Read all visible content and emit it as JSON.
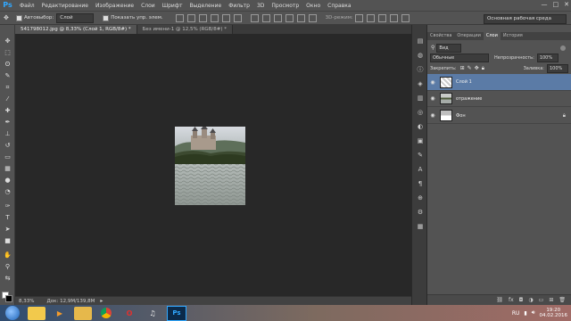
{
  "app": {
    "logo": "Ps"
  },
  "menu": [
    "Файл",
    "Редактирование",
    "Изображение",
    "Слои",
    "Шрифт",
    "Выделение",
    "Фильтр",
    "3D",
    "Просмотр",
    "Окно",
    "Справка"
  ],
  "window_controls": [
    "—",
    "□",
    "✕"
  ],
  "options": {
    "autoselect_label": "Автовыбор:",
    "autoselect_value": "Слой",
    "show_transform_label": "Показать упр. элем.",
    "mode3d_label": "3D-режим:",
    "workspace": "Основная рабочая среда"
  },
  "tabs": [
    {
      "label": "541798012.jpg @ 8,33% (Слой 1, RGB/8#) *",
      "active": true
    },
    {
      "label": "Без имени-1 @ 12,5% (RGB/8#) *",
      "active": false
    }
  ],
  "status": {
    "zoom": "8,33%",
    "doc": "Док: 12,9M/139,8M"
  },
  "panel": {
    "tabs": [
      "Свойства",
      "Операции",
      "Слои",
      "История"
    ],
    "active_tab": "Слои",
    "kind_select": "Вид",
    "blend_mode": "Обычные",
    "opacity_label": "Непрозрачность:",
    "opacity_value": "100%",
    "lock_label": "Закрепить:",
    "fill_label": "Заливка:",
    "fill_value": "100%",
    "layers": [
      {
        "name": "Слой 1",
        "selected": true
      },
      {
        "name": "отражение",
        "selected": false
      },
      {
        "name": "Фон",
        "selected": false
      }
    ]
  },
  "taskbar": {
    "lang": "RU",
    "time": "19:20",
    "date": "04.02.2016",
    "apps": [
      "explorer",
      "media-player",
      "folder",
      "chrome",
      "opera",
      "headphones",
      "photoshop"
    ]
  },
  "colors": {
    "accent": "#31a8ff",
    "selected_layer": "#5b7ba6"
  }
}
